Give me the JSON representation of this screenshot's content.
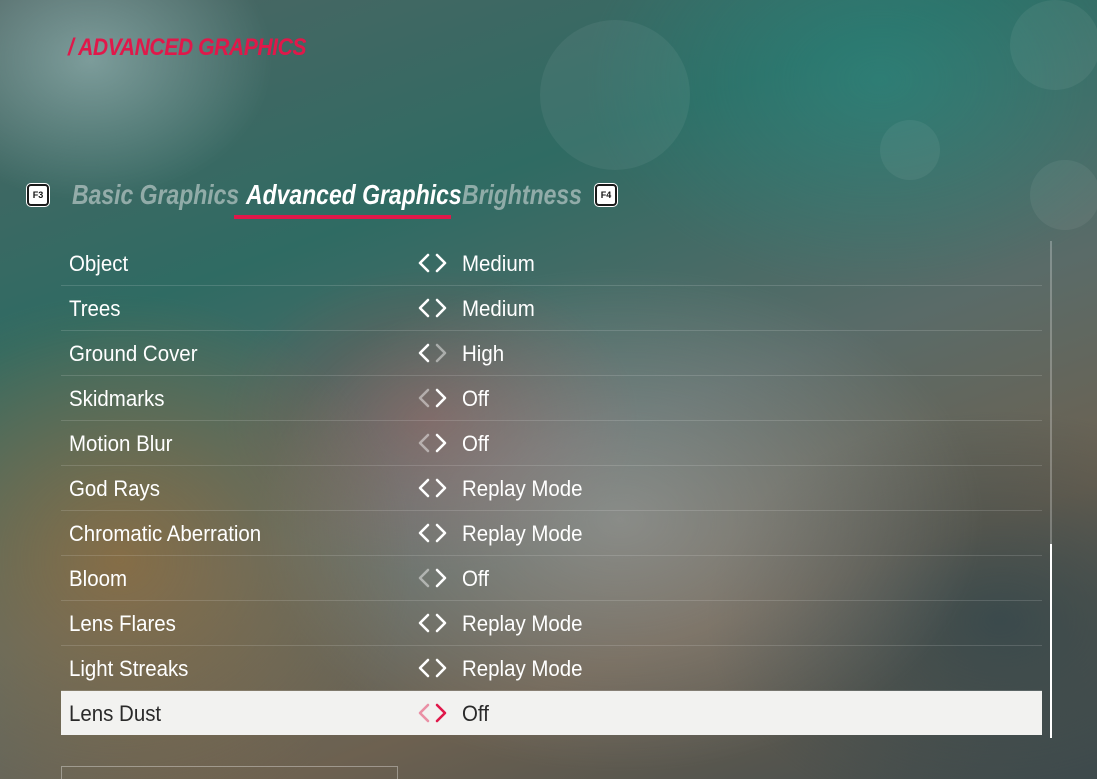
{
  "header": {
    "title": "/ ADVANCED GRAPHICS"
  },
  "tabs": {
    "prev_key": "F3",
    "next_key": "F4",
    "items": [
      {
        "label": "Basic Graphics",
        "active": false
      },
      {
        "label": "Advanced Graphics",
        "active": true
      },
      {
        "label": "Brightness",
        "active": false
      }
    ]
  },
  "colors": {
    "accent": "#e0184a",
    "arrow_active": "#ffffff",
    "arrow_dim": "rgba(255,255,255,0.45)"
  },
  "settings": [
    {
      "label": "Object",
      "value": "Medium",
      "left_enabled": true,
      "right_enabled": true
    },
    {
      "label": "Trees",
      "value": "Medium",
      "left_enabled": true,
      "right_enabled": true
    },
    {
      "label": "Ground Cover",
      "value": "High",
      "left_enabled": true,
      "right_enabled": false
    },
    {
      "label": "Skidmarks",
      "value": "Off",
      "left_enabled": false,
      "right_enabled": true
    },
    {
      "label": "Motion Blur",
      "value": "Off",
      "left_enabled": false,
      "right_enabled": true
    },
    {
      "label": "God Rays",
      "value": "Replay Mode",
      "left_enabled": true,
      "right_enabled": true
    },
    {
      "label": "Chromatic Aberration",
      "value": "Replay Mode",
      "left_enabled": true,
      "right_enabled": true
    },
    {
      "label": "Bloom",
      "value": "Off",
      "left_enabled": false,
      "right_enabled": true
    },
    {
      "label": "Lens Flares",
      "value": "Replay Mode",
      "left_enabled": true,
      "right_enabled": true
    },
    {
      "label": "Light Streaks",
      "value": "Replay Mode",
      "left_enabled": true,
      "right_enabled": true
    },
    {
      "label": "Lens Dust",
      "value": "Off",
      "left_enabled": false,
      "right_enabled": true,
      "selected": true
    }
  ],
  "scrollbar": {
    "position": 0.61
  }
}
